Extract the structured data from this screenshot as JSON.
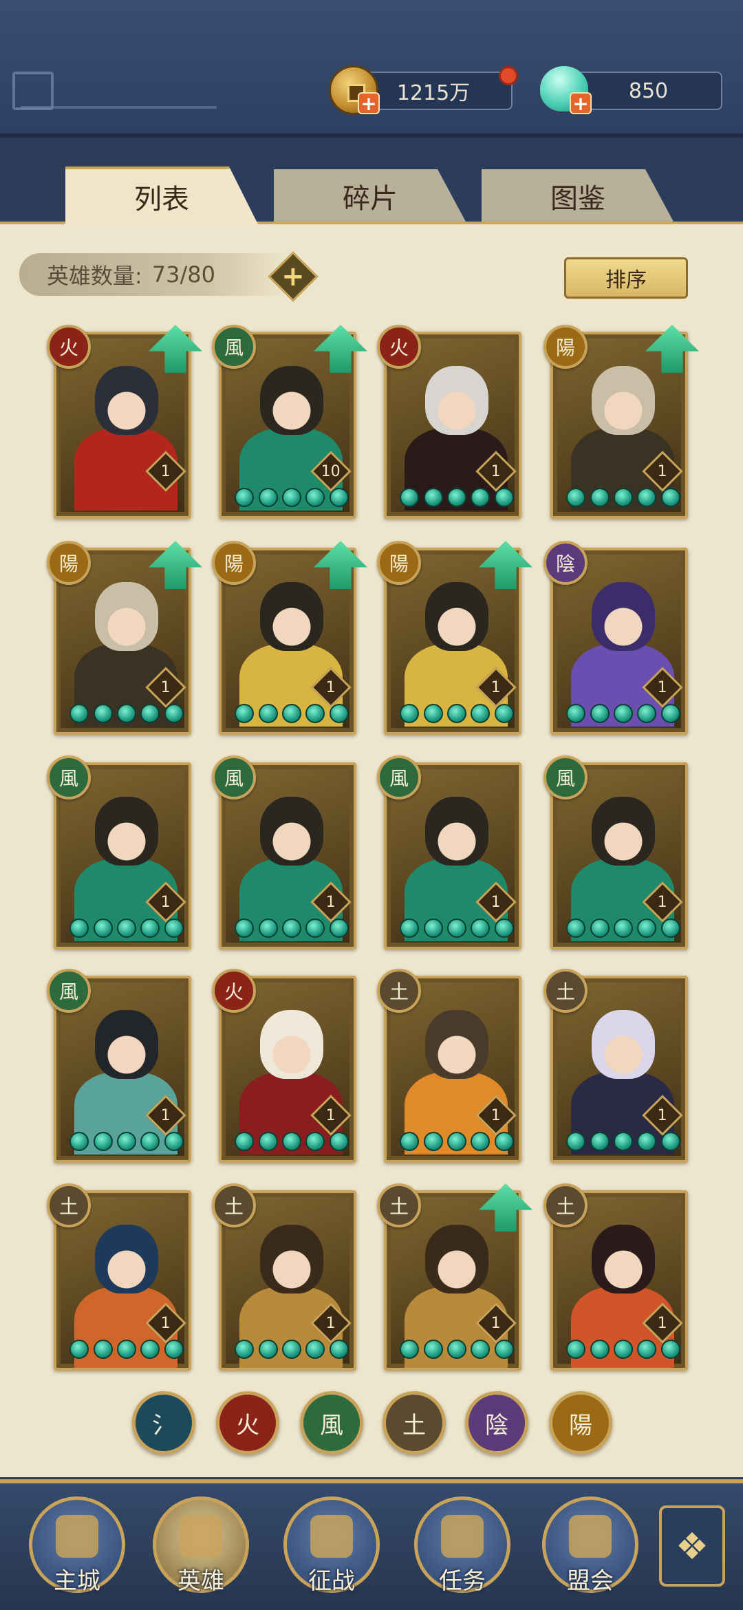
{
  "currencies": {
    "coin": "1215万",
    "gem": "850"
  },
  "tabs": [
    "列表",
    "碎片",
    "图鉴"
  ],
  "hero_count": {
    "label": "英雄数量:",
    "value": "73/80"
  },
  "sort_label": "排序",
  "element_glyphs": {
    "water": "氵",
    "fire": "火",
    "wind": "風",
    "earth": "土",
    "yin": "陰",
    "yang": "陽"
  },
  "element_colors": {
    "water": "#1c4a5c",
    "fire": "#8a2418",
    "wind": "#2d6a3e",
    "earth": "#5a4a30",
    "yin": "#5a3a7a",
    "yang": "#9a6a14"
  },
  "heroes": [
    {
      "element": "fire",
      "level": "1",
      "upgrade": true,
      "stars": 0,
      "palette": [
        "#2c2f3a",
        "#b3261c"
      ]
    },
    {
      "element": "wind",
      "level": "10",
      "upgrade": true,
      "stars": 5,
      "palette": [
        "#2b2620",
        "#1e8a6a"
      ]
    },
    {
      "element": "fire",
      "level": "1",
      "upgrade": false,
      "stars": 5,
      "palette": [
        "#d8d5d0",
        "#2a1a1a"
      ]
    },
    {
      "element": "yang",
      "level": "1",
      "upgrade": true,
      "stars": 5,
      "palette": [
        "#c9bfa8",
        "#3a3222"
      ]
    },
    {
      "element": "yang",
      "level": "1",
      "upgrade": true,
      "stars": 5,
      "palette": [
        "#c9bfa8",
        "#3a3222"
      ]
    },
    {
      "element": "yang",
      "level": "1",
      "upgrade": true,
      "stars": 5,
      "palette": [
        "#2b2620",
        "#d8b440"
      ]
    },
    {
      "element": "yang",
      "level": "1",
      "upgrade": true,
      "stars": 5,
      "palette": [
        "#2b2620",
        "#d8b440"
      ]
    },
    {
      "element": "yin",
      "level": "1",
      "upgrade": false,
      "stars": 5,
      "palette": [
        "#3a2d6a",
        "#6a4fb0"
      ]
    },
    {
      "element": "wind",
      "level": "1",
      "upgrade": false,
      "stars": 5,
      "palette": [
        "#2b2620",
        "#1e8a6a"
      ]
    },
    {
      "element": "wind",
      "level": "1",
      "upgrade": false,
      "stars": 5,
      "palette": [
        "#2b2620",
        "#1e8a6a"
      ]
    },
    {
      "element": "wind",
      "level": "1",
      "upgrade": false,
      "stars": 5,
      "palette": [
        "#2b2620",
        "#1e8a6a"
      ]
    },
    {
      "element": "wind",
      "level": "1",
      "upgrade": false,
      "stars": 5,
      "palette": [
        "#2b2620",
        "#1e8a6a"
      ]
    },
    {
      "element": "wind",
      "level": "1",
      "upgrade": false,
      "stars": 5,
      "palette": [
        "#22262a",
        "#5aa39a"
      ]
    },
    {
      "element": "fire",
      "level": "1",
      "upgrade": false,
      "stars": 5,
      "palette": [
        "#efe7d8",
        "#8a1e1e"
      ]
    },
    {
      "element": "earth",
      "level": "1",
      "upgrade": false,
      "stars": 5,
      "palette": [
        "#4a3a2a",
        "#e08a2a"
      ]
    },
    {
      "element": "earth",
      "level": "1",
      "upgrade": false,
      "stars": 5,
      "palette": [
        "#dcd6ea",
        "#2a2a44"
      ]
    },
    {
      "element": "earth",
      "level": "1",
      "upgrade": false,
      "stars": 5,
      "palette": [
        "#1e3a5a",
        "#d0662a"
      ]
    },
    {
      "element": "earth",
      "level": "1",
      "upgrade": false,
      "stars": 5,
      "palette": [
        "#3a2a1a",
        "#b88a3a"
      ]
    },
    {
      "element": "earth",
      "level": "1",
      "upgrade": true,
      "stars": 5,
      "palette": [
        "#3a2a1a",
        "#b88a3a"
      ]
    },
    {
      "element": "earth",
      "level": "1",
      "upgrade": false,
      "stars": 5,
      "palette": [
        "#2a1a1a",
        "#d2552a"
      ]
    }
  ],
  "filters": [
    "water",
    "fire",
    "wind",
    "earth",
    "yin",
    "yang"
  ],
  "nav": [
    {
      "label": "主城",
      "icon": "city-gate-icon"
    },
    {
      "label": "英雄",
      "icon": "hero-portrait-icon",
      "active": true
    },
    {
      "label": "征战",
      "icon": "battle-icon"
    },
    {
      "label": "任务",
      "icon": "scroll-icon"
    },
    {
      "label": "盟会",
      "icon": "alliance-pavilion-icon"
    }
  ]
}
